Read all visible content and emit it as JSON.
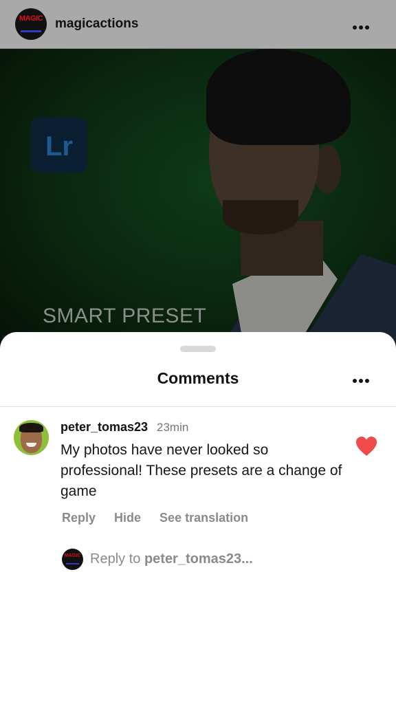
{
  "header": {
    "username": "magicactions",
    "avatar_text": "MAGIC",
    "more_icon": "more-horizontal-icon"
  },
  "photo": {
    "badge_text": "Lr",
    "caption": "SMART PRESET"
  },
  "comments_sheet": {
    "title": "Comments",
    "more_icon": "more-horizontal-icon",
    "comment": {
      "username": "peter_tomas23",
      "time": "23min",
      "text": "My photos have never looked so professional! These presets are a change of game",
      "liked": true,
      "like_color": "#f04a4a",
      "actions": {
        "reply": "Reply",
        "hide": "Hide",
        "see_translation": "See translation"
      }
    },
    "reply_input": {
      "prefix": "Reply to ",
      "target": "peter_tomas23..."
    }
  }
}
